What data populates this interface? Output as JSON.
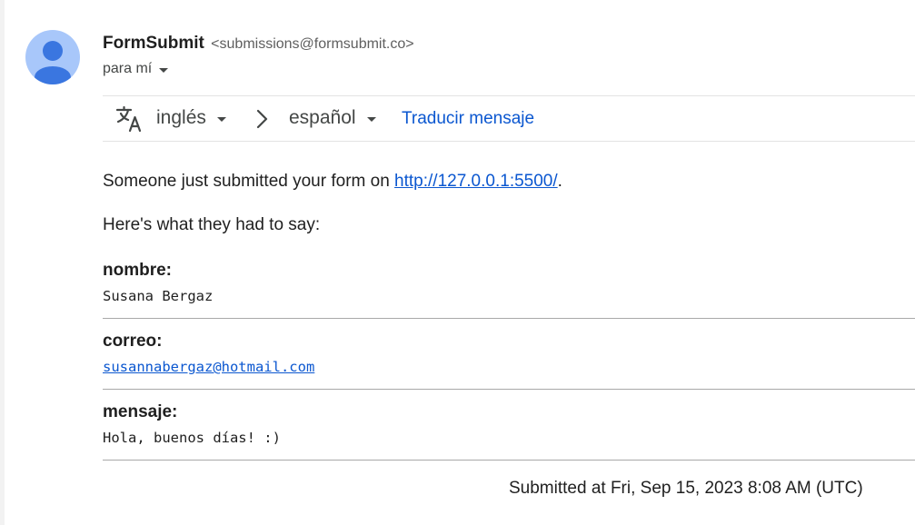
{
  "sender": {
    "name": "FormSubmit",
    "email": "<submissions@formsubmit.co>"
  },
  "recipient_label": "para mí",
  "translation": {
    "from_lang": "inglés",
    "to_lang": "español",
    "translate_link": "Traducir mensaje"
  },
  "message": {
    "intro_prefix": "Someone just submitted your form on ",
    "intro_link": "http://127.0.0.1:5500/",
    "intro_suffix": ".",
    "subheading": "Here's what they had to say:",
    "fields": [
      {
        "label": "nombre:",
        "value": "Susana Bergaz"
      },
      {
        "label": "correo:",
        "value": "susannabergaz@hotmail.com"
      },
      {
        "label": "mensaje:",
        "value": "Hola, buenos días! :)"
      }
    ],
    "footer": "Submitted at Fri, Sep 15, 2023 8:08 AM (UTC)"
  },
  "colors": {
    "link": "#0b57d0",
    "avatar_bg": "#a8c7fa",
    "avatar_fg": "#3a76e0"
  }
}
